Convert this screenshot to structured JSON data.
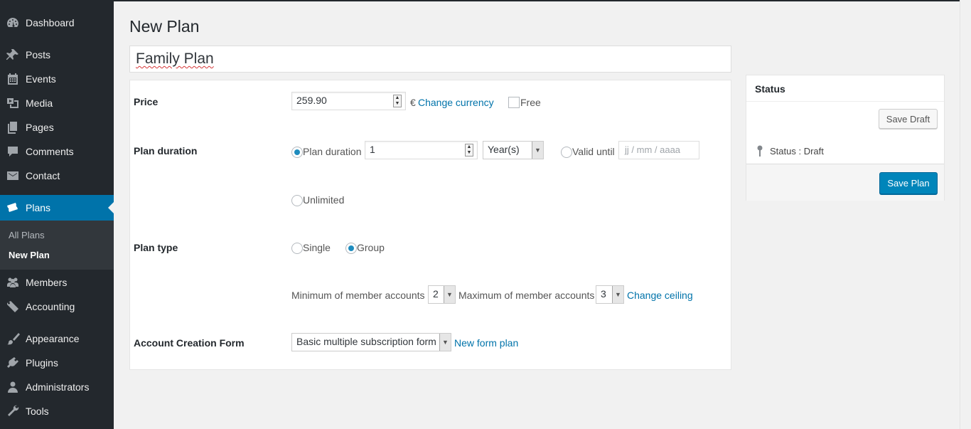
{
  "sidebar": {
    "items": [
      {
        "label": "Dashboard",
        "icon": "dashboard-icon"
      },
      {
        "label": "Posts",
        "icon": "pin-icon"
      },
      {
        "label": "Events",
        "icon": "calendar-icon"
      },
      {
        "label": "Media",
        "icon": "media-icon"
      },
      {
        "label": "Pages",
        "icon": "pages-icon"
      },
      {
        "label": "Comments",
        "icon": "comment-icon"
      },
      {
        "label": "Contact",
        "icon": "mail-icon"
      },
      {
        "label": "Plans",
        "icon": "tickets-icon"
      },
      {
        "label": "Members",
        "icon": "groups-icon"
      },
      {
        "label": "Accounting",
        "icon": "tag-icon"
      },
      {
        "label": "Appearance",
        "icon": "brush-icon"
      },
      {
        "label": "Plugins",
        "icon": "plugin-icon"
      },
      {
        "label": "Administrators",
        "icon": "user-icon"
      },
      {
        "label": "Tools",
        "icon": "wrench-icon"
      }
    ],
    "submenu": {
      "all_plans": "All Plans",
      "new_plan": "New Plan"
    }
  },
  "page": {
    "title": "New Plan",
    "plan_name": "Family Plan"
  },
  "form": {
    "price": {
      "label": "Price",
      "value": "259.90",
      "currency_symbol": "€",
      "change_currency": "Change currency",
      "free_label": "Free"
    },
    "duration": {
      "label": "Plan duration",
      "radio_label": "Plan duration",
      "value": "1",
      "unit": "Year(s)",
      "valid_until_label": "Valid until",
      "date_placeholder": "jj / mm / aaaa",
      "unlimited_label": "Unlimited"
    },
    "plan_type": {
      "label": "Plan type",
      "single_label": "Single",
      "group_label": "Group",
      "min_label": "Minimum of member accounts",
      "min_value": "2",
      "max_label": "Maximum of member accounts",
      "max_value": "3",
      "change_ceiling": "Change ceiling"
    },
    "account_form": {
      "label": "Account Creation Form",
      "value": "Basic multiple subscription form",
      "new_form_link": "New form plan"
    }
  },
  "status_box": {
    "title": "Status",
    "save_draft": "Save Draft",
    "status_text": "Status : Draft",
    "save_plan": "Save Plan"
  },
  "colors": {
    "sidebar_bg": "#23282d",
    "accent": "#0073aa",
    "primary_button": "#0085ba"
  }
}
